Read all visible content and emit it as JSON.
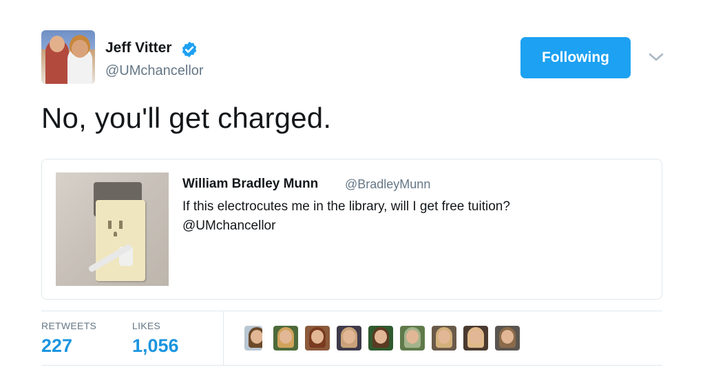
{
  "author": {
    "name": "Jeff Vitter",
    "handle": "@UMchancellor",
    "verified": true,
    "avatar_icon": "profile-photo"
  },
  "follow_button": {
    "label": "Following",
    "color": "#1da1f2"
  },
  "menu_icon": "chevron-down-icon",
  "tweet": {
    "text": "No, you'll get charged."
  },
  "quoted_tweet": {
    "author_name": "William Bradley Munn",
    "author_handle": "@BradleyMunn",
    "text_line1": "If this electrocutes me in the library, will I get free tuition?",
    "text_line2": "@UMchancellor",
    "image_icon": "electrical-outlet-photo"
  },
  "stats": {
    "retweets_label": "RETWEETS",
    "retweets_value": "227",
    "likes_label": "LIKES",
    "likes_value": "1,056"
  },
  "likers": [
    {
      "bg": "#b9c6d3",
      "hair": "#6b4a2a"
    },
    {
      "bg": "#4d6a3a",
      "hair": "#d1a35c"
    },
    {
      "bg": "#8c5a3c",
      "hair": "#7a3b20"
    },
    {
      "bg": "#3f3a4a",
      "hair": "#caa27a"
    },
    {
      "bg": "#2f5a2f",
      "hair": "#5a3a22"
    },
    {
      "bg": "#5f7a4a",
      "hair": "#a3b38a"
    },
    {
      "bg": "#6a5a4a",
      "hair": "#d2b07a"
    },
    {
      "bg": "#4a3a30",
      "hair": "#e0b98a"
    },
    {
      "bg": "#5a5550",
      "hair": "#8a6a4a"
    }
  ],
  "colors": {
    "accent": "#1da1f2",
    "stat_value": "#1b95e0",
    "secondary_text": "#657786",
    "border": "#e1e8ed"
  }
}
